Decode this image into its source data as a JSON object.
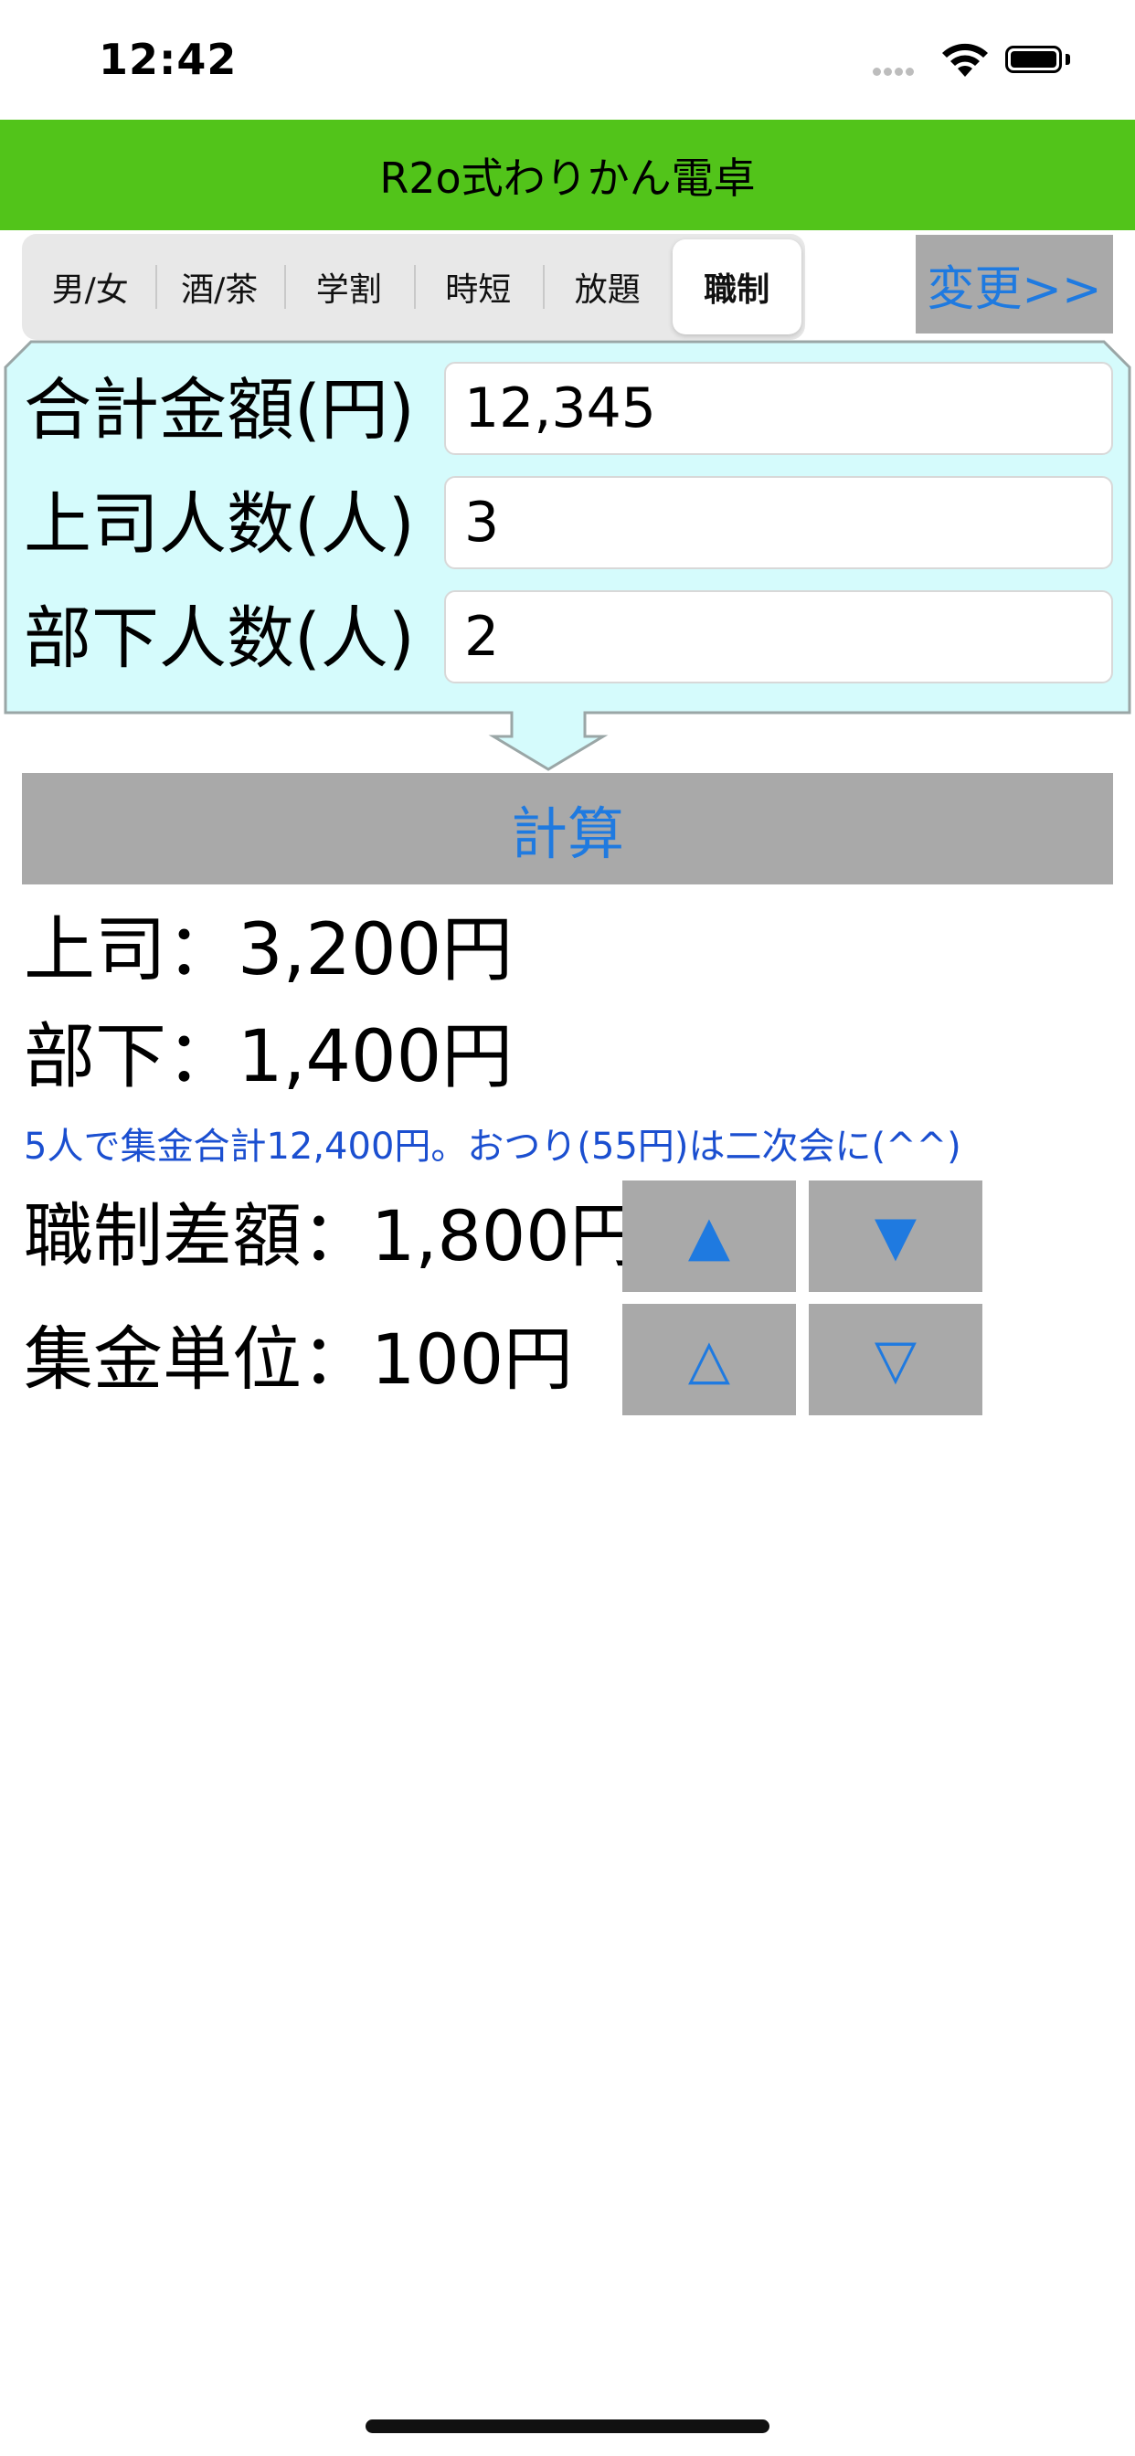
{
  "status_bar": {
    "time": "12:42"
  },
  "header": {
    "title": "R2o式わりかん電卓"
  },
  "segments": {
    "items": [
      {
        "label": "男/女"
      },
      {
        "label": "酒/茶"
      },
      {
        "label": "学割"
      },
      {
        "label": "時短"
      },
      {
        "label": "放題"
      },
      {
        "label": "職制"
      }
    ],
    "selected": "職制"
  },
  "change_button": {
    "label": "変更>>"
  },
  "inputs": {
    "total": {
      "label": "合計金額(円)",
      "value": "12,345"
    },
    "bosses": {
      "label": "上司人数(人)",
      "value": "3"
    },
    "subordinates": {
      "label": "部下人数(人)",
      "value": "2"
    }
  },
  "calculate_button": {
    "label": "計算"
  },
  "results": {
    "boss": "上司：3,200円",
    "subordinate": "部下：1,400円",
    "note": "5人で集金合計12,400円。おつり(55円)は二次会に(^^)"
  },
  "adjustments": {
    "difference": {
      "label": "職制差額：1,800円",
      "up": "▲",
      "down": "▼"
    },
    "unit": {
      "label": "集金単位：100円",
      "up": "△",
      "down": "▽"
    }
  },
  "colors": {
    "header_bg": "#52c41a",
    "panel_bg": "#d5fbfc",
    "button_bg": "#a9a9a9",
    "accent_blue": "#1f7ae0",
    "note_blue": "#1b4fd0"
  }
}
